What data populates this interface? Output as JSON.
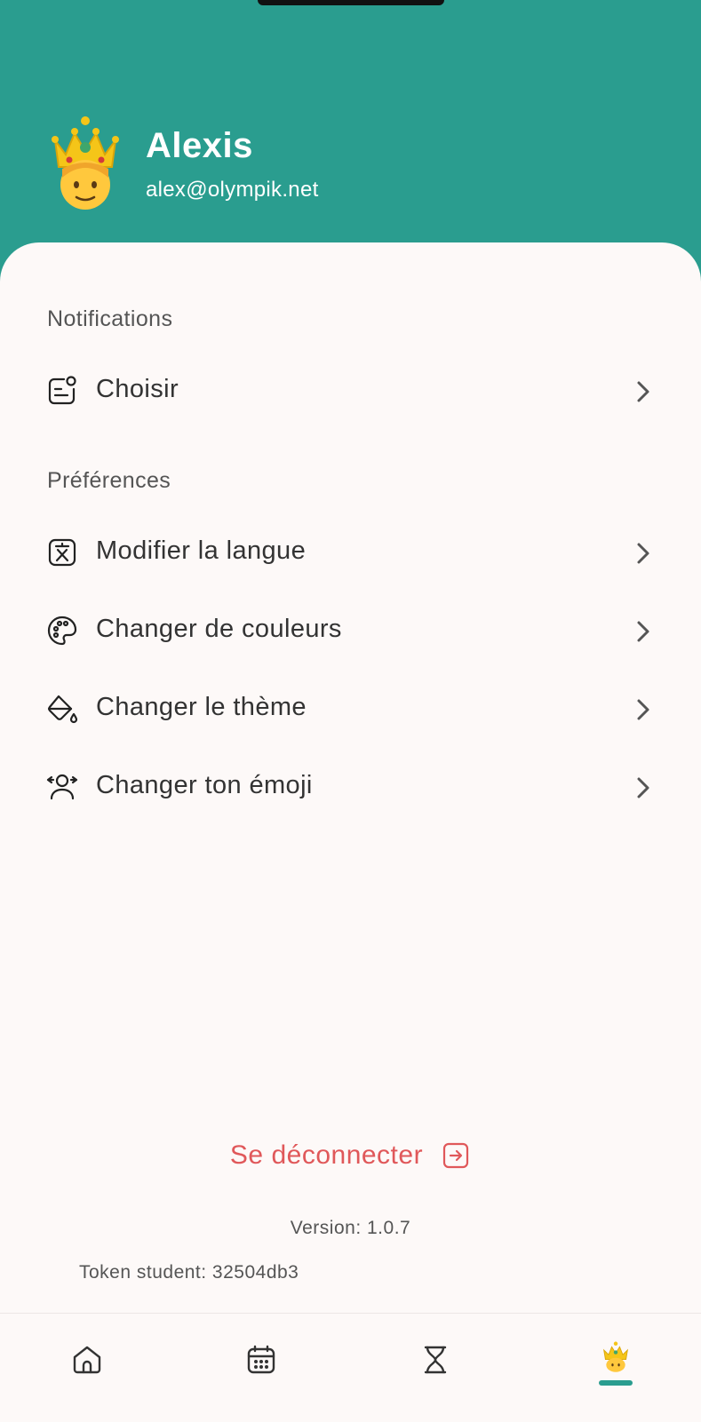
{
  "user": {
    "name": "Alexis",
    "email": "alex@olympik.net",
    "avatar_icon": "prince-emoji"
  },
  "sections": {
    "notifications": {
      "title": "Notifications",
      "items": [
        {
          "label": "Choisir",
          "icon": "notification-settings-icon"
        }
      ]
    },
    "preferences": {
      "title": "Préférences",
      "items": [
        {
          "label": "Modifier la langue",
          "icon": "translate-icon"
        },
        {
          "label": "Changer de couleurs",
          "icon": "palette-icon"
        },
        {
          "label": "Changer le thème",
          "icon": "paint-bucket-icon"
        },
        {
          "label": "Changer ton émoji",
          "icon": "user-swap-icon"
        }
      ]
    }
  },
  "logout": {
    "label": "Se déconnecter",
    "icon": "logout-icon"
  },
  "footer": {
    "version": "Version: 1.0.7",
    "token": "Token student: 32504db3"
  },
  "tabbar": {
    "items": [
      {
        "icon": "home-icon",
        "active": false
      },
      {
        "icon": "calendar-icon",
        "active": false
      },
      {
        "icon": "hourglass-icon",
        "active": false
      },
      {
        "icon": "profile-emoji-icon",
        "active": true
      }
    ]
  },
  "colors": {
    "header": "#2a9d8f",
    "background": "#fdf9f8",
    "logout": "#e0585a",
    "text": "#333333"
  }
}
